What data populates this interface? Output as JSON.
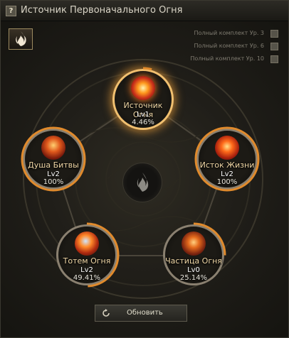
{
  "window": {
    "title": "Источник Первоначального Огня"
  },
  "sets": [
    {
      "label": "Полный комплект Ур. 3"
    },
    {
      "label": "Полный комплект Ур. 6"
    },
    {
      "label": "Полный комплект Ур. 10"
    }
  ],
  "nodes": {
    "source": {
      "name": "Источник Огня",
      "level": "Lv1",
      "progress": "4.46%",
      "progress_value": 4.46,
      "icon": "fire-orb-icon"
    },
    "battle_soul": {
      "name": "Душа Битвы",
      "level": "Lv2",
      "progress": "100%",
      "progress_value": 100,
      "icon": "flame-warrior-icon"
    },
    "life_source": {
      "name": "Исток Жизни",
      "level": "Lv2",
      "progress": "100%",
      "progress_value": 100,
      "icon": "fire-wings-icon"
    },
    "fire_totem": {
      "name": "Тотем Огня",
      "level": "Lv2",
      "progress": "49.41%",
      "progress_value": 49.41,
      "icon": "fire-totem-icon"
    },
    "fire_particle": {
      "name": "Частица Огня",
      "level": "Lv0",
      "progress": "25.14%",
      "progress_value": 25.14,
      "icon": "fire-particle-icon"
    }
  },
  "refresh_button": {
    "label": "Обновить",
    "icon": "refresh-icon"
  },
  "colors": {
    "progress_arc": "#e08a2c",
    "active_glow": "#f1c070",
    "name_text": "#f0d7a6"
  }
}
